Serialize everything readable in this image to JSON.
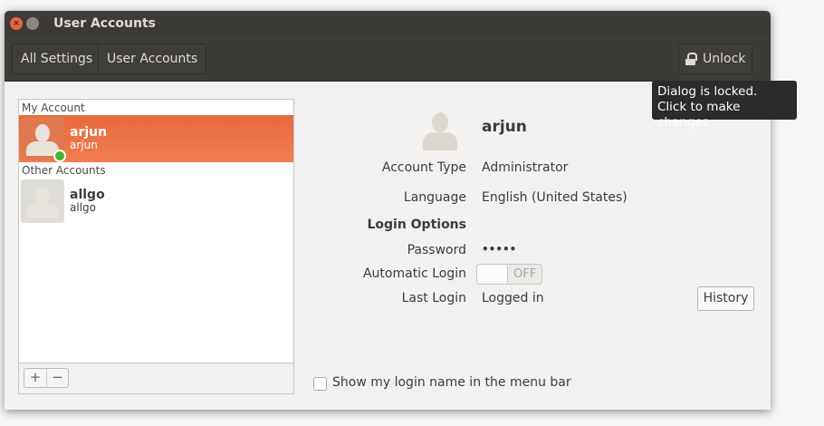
{
  "window": {
    "title": "User Accounts"
  },
  "toolbar": {
    "all_settings": "All Settings",
    "user_accounts": "User Accounts",
    "unlock": "Unlock"
  },
  "tooltip": {
    "line1": "Dialog is locked.",
    "line2": "Click to make changes"
  },
  "accounts": {
    "my_account_header": "My Account",
    "other_accounts_header": "Other Accounts",
    "my": {
      "name": "arjun",
      "login": "arjun",
      "online": true
    },
    "others": [
      {
        "name": "allgo",
        "login": "allgo"
      }
    ],
    "add": "+",
    "remove": "−"
  },
  "details": {
    "name": "arjun",
    "account_type_label": "Account Type",
    "account_type": "Administrator",
    "language_label": "Language",
    "language": "English (United States)",
    "login_options": "Login Options",
    "password_label": "Password",
    "password": "•••••",
    "auto_login_label": "Automatic Login",
    "auto_login": "OFF",
    "last_login_label": "Last Login",
    "last_login": "Logged in",
    "history": "History",
    "show_login_name": "Show my login name in the menu bar"
  }
}
